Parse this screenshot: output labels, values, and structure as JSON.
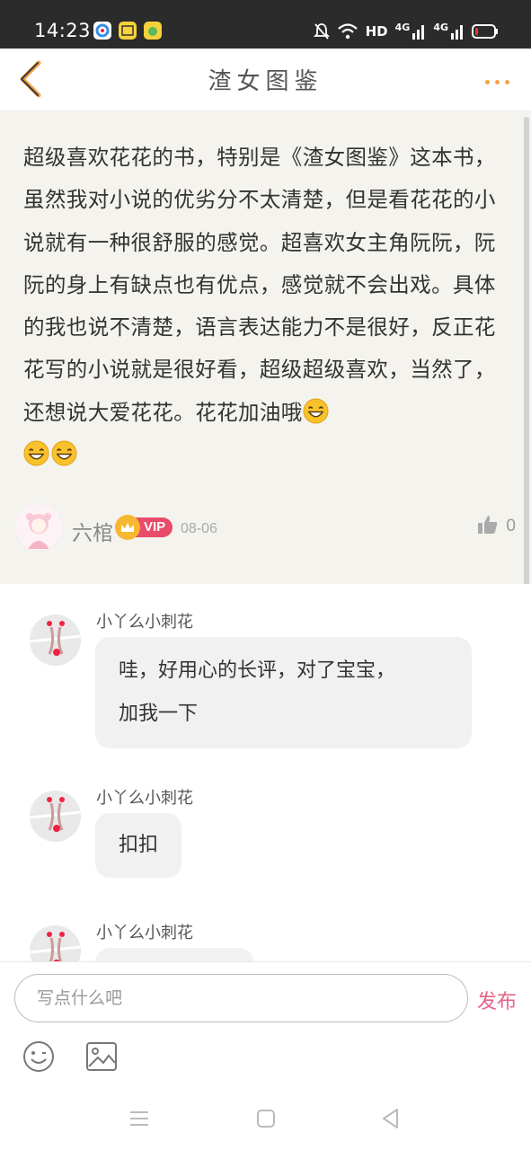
{
  "status_bar": {
    "time": "14:23",
    "network_hd": "HD",
    "network_4g_1": "4G",
    "network_4g_2": "4G",
    "icons": [
      "app-notification-icon",
      "mute-icon",
      "wifi-icon",
      "signal-icon",
      "battery-icon"
    ]
  },
  "header": {
    "title": "渣女图鉴",
    "back_icon": "chevron-left-icon",
    "more_icon": "more-dots-icon",
    "accent_color": "#f5a24a"
  },
  "review": {
    "text": "超级喜欢花花的书，特别是《渣女图鉴》这本书，虽然我对小说的优劣分不太清楚，但是看花花的小说就有一种很舒服的感觉。超喜欢女主角阮阮，阮阮的身上有缺点也有优点，感觉就不会出戏。具体的我也说不清楚，语言表达能力不是很好，反正花花写的小说就是很好看，超级超级喜欢，当然了，还想说大爱花花。花花加油哦",
    "author": "六棺",
    "vip_label": "VIP",
    "date": "08-06",
    "like_count": "0",
    "background_color": "#f4f3ee"
  },
  "comments": [
    {
      "user": "小丫么小刺花",
      "text_lines": [
        "哇，好用心的长评，对了宝宝，",
        "加我一下"
      ]
    },
    {
      "user": "小丫么小刺花",
      "text_lines": [
        "扣扣"
      ]
    },
    {
      "user": "小丫么小刺花",
      "text_lines": [
        ""
      ]
    }
  ],
  "input_bar": {
    "placeholder": "写点什么吧",
    "publish_label": "发布",
    "publish_color": "#e4648a"
  }
}
